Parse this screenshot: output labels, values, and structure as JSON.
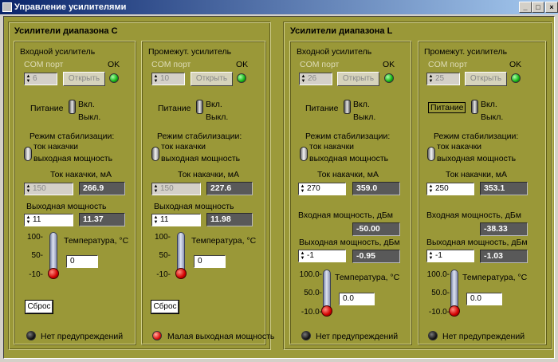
{
  "window": {
    "title": "Управление усилителями",
    "min": "_",
    "max": "□",
    "close": "×"
  },
  "groups": {
    "c": {
      "title": "Усилители диапазона C"
    },
    "l": {
      "title": "Усилители диапазона L"
    }
  },
  "common": {
    "com_port": "COM порт",
    "ok": "OK",
    "open": "Открыть",
    "power": "Питание",
    "on": "Вкл.",
    "off": "Выкл.",
    "mode": "Режим стабилизации:",
    "pump": "ток накачки",
    "outpow": "выходная мощность",
    "pump_current": "Ток накачки, мА",
    "output_power": "Выходная мощность",
    "in_power_dbm": "Входная мощность, дБм",
    "out_power_dbm": "Выходная мощность, дБм",
    "temperature": "Температура, °С",
    "reset": "Сброс"
  },
  "panels": [
    {
      "title": "Входной усилитель",
      "com": "6",
      "pump_set": "150",
      "pump_val": "266.9",
      "pow_set": "11",
      "pow_val": "11.37",
      "temp": "0",
      "status": "Нет предупреждений",
      "t100": "100-",
      "t50": "50-",
      "tm10": "-10-"
    },
    {
      "title": "Промежут. усилитель",
      "com": "10",
      "pump_set": "150",
      "pump_val": "227.6",
      "pow_set": "11",
      "pow_val": "11.98",
      "temp": "0",
      "status": "Малая выходная мощность",
      "t100": "100-",
      "t50": "50-",
      "tm10": "-10-"
    },
    {
      "title": "Входной усилитель",
      "com": "26",
      "pump_set": "270",
      "pump_val": "359.0",
      "in_val": "-50.00",
      "pow_set": "-1",
      "pow_val": "-0.95",
      "temp": "0.0",
      "status": "Нет предупреждений",
      "t100": "100.0-",
      "t50": "50.0-",
      "tm10": "-10.0-"
    },
    {
      "title": "Промежут. усилитель",
      "com": "25",
      "pump_set": "250",
      "pump_val": "353.1",
      "in_val": "-38.33",
      "pow_set": "-1",
      "pow_val": "-1.03",
      "temp": "0.0",
      "status": "Нет предупреждений",
      "t100": "100.0-",
      "t50": "50.0-",
      "tm10": "-10.0-"
    }
  ]
}
